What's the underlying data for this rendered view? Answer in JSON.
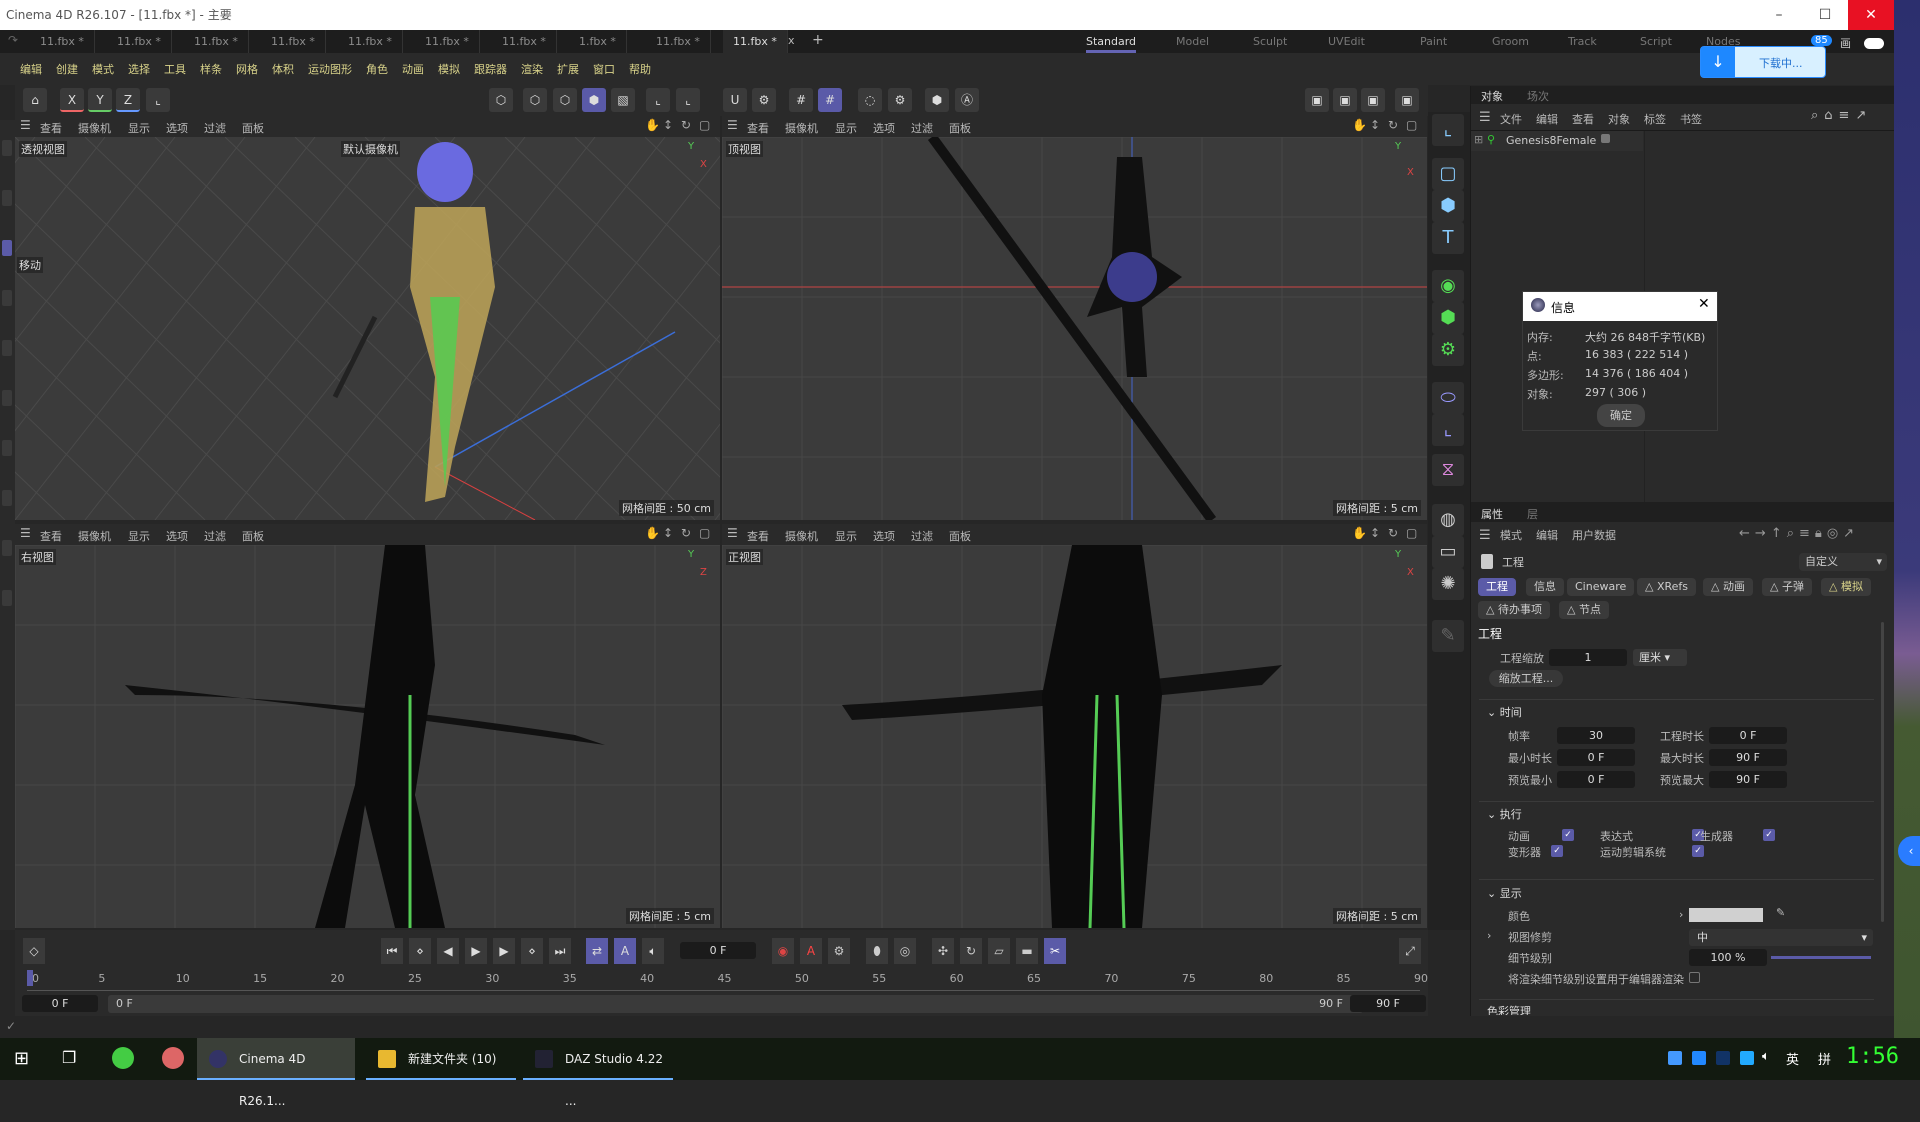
{
  "window": {
    "title": "Cinema 4D R26.107 - [11.fbx *] - 主要",
    "minimize": "–",
    "maximize": "☐",
    "close": "✕"
  },
  "doc_tabs": [
    "11.fbx *",
    "11.fbx *",
    "11.fbx *",
    "11.fbx *",
    "11.fbx *",
    "11.fbx *",
    "11.fbx *",
    "1.fbx *",
    "11.fbx *",
    "11.fbx *"
  ],
  "doc_tab_close": "x",
  "doc_tab_add": "+",
  "layouts": [
    "Standard",
    "Model",
    "Sculpt",
    "UVEdit",
    "Paint",
    "Groom",
    "Track",
    "Script",
    "Nodes"
  ],
  "active_layout": "Standard",
  "download": {
    "label": "下载中...",
    "badge": "85",
    "extra": "画"
  },
  "menu": [
    "编辑",
    "创建",
    "模式",
    "选择",
    "工具",
    "样条",
    "网格",
    "体积",
    "运动图形",
    "角色",
    "动画",
    "模拟",
    "跟踪器",
    "渲染",
    "扩展",
    "窗口",
    "帮助"
  ],
  "toolbar": {
    "axes": [
      "X",
      "Y",
      "Z"
    ]
  },
  "viewport_menu": [
    "查看",
    "摄像机",
    "显示",
    "选项",
    "过滤",
    "面板"
  ],
  "viewports": [
    {
      "name": "透视视图",
      "camera": "默认摄像机",
      "grid": "网格间距 : 50 cm",
      "hud": "移动"
    },
    {
      "name": "顶视图",
      "grid": "网格间距 : 5 cm"
    },
    {
      "name": "右视图",
      "grid": "网格间距 : 5 cm"
    },
    {
      "name": "正视图",
      "grid": "网格间距 : 5 cm"
    }
  ],
  "object_manager": {
    "tabs": [
      "对象",
      "场次"
    ],
    "menu": [
      "文件",
      "编辑",
      "查看",
      "对象",
      "标签",
      "书签"
    ],
    "objects": [
      {
        "name": "Genesis8Female"
      }
    ]
  },
  "info_dialog": {
    "title": "信息",
    "rows": [
      {
        "label": "内存:",
        "value": "大约 26 848千字节(KB)"
      },
      {
        "label": "点:",
        "value": "16 383 ( 222 514 )"
      },
      {
        "label": "多边形:",
        "value": "14 376 ( 186 404 )"
      },
      {
        "label": "对象:",
        "value": "297 ( 306 )"
      }
    ],
    "ok": "确定"
  },
  "attributes": {
    "tabs": [
      "属性",
      "层"
    ],
    "menu": [
      "模式",
      "编辑",
      "用户数据"
    ],
    "object": "工程",
    "preset": "自定义",
    "chips": [
      "工程",
      "信息",
      "Cineware",
      "XRefs",
      "动画",
      "子弹",
      "模拟",
      "待办事项",
      "节点"
    ],
    "section_title": "工程",
    "scale_label": "工程缩放",
    "scale_value": "1",
    "scale_unit": "厘米",
    "scale_button": "缩放工程...",
    "time": {
      "title": "时间",
      "fps_label": "帧率",
      "fps": "30",
      "length_label": "工程时长",
      "length": "0 F",
      "min_label": "最小时长",
      "min": "0 F",
      "max_label": "最大时长",
      "max": "90 F",
      "pmin_label": "预览最小",
      "pmin": "0 F",
      "pmax_label": "预览最大",
      "pmax": "90 F"
    },
    "exec": {
      "title": "执行",
      "items": [
        {
          "label": "动画",
          "checked": true
        },
        {
          "label": "表达式",
          "checked": true
        },
        {
          "label": "生成器",
          "checked": true
        },
        {
          "label": "变形器",
          "checked": true
        },
        {
          "label": "运动剪辑系统",
          "checked": true
        }
      ]
    },
    "display": {
      "title": "显示",
      "color_label": "颜色",
      "color": "#d0d0d0",
      "clip_label": "视图修剪",
      "clip": "中",
      "lod_label": "细节级别",
      "lod": "100 %",
      "lod_fraction": 1.0,
      "render_lod_label": "将渲染细节级别设置用于编辑器渲染",
      "render_lod": false
    },
    "next_section": "色彩管理"
  },
  "timeline": {
    "current": "0 F",
    "ticks": [
      "0",
      "5",
      "10",
      "15",
      "20",
      "25",
      "30",
      "35",
      "40",
      "45",
      "50",
      "55",
      "60",
      "65",
      "70",
      "75",
      "80",
      "85",
      "90"
    ],
    "start": "0 F",
    "range_start": "0 F",
    "range_end": "90 F",
    "end": "90 F",
    "max_frame": 90
  },
  "taskbar": {
    "apps": [
      "Cinema 4D R26.1...",
      "新建文件夹 (10)",
      "DAZ Studio 4.22 ..."
    ],
    "ime": "英",
    "ime2": "拼",
    "clock": "1:56"
  },
  "colors": {
    "accent": "#5b5ba8",
    "menu_text": "#d9d38a",
    "clock": "#33ff33"
  }
}
